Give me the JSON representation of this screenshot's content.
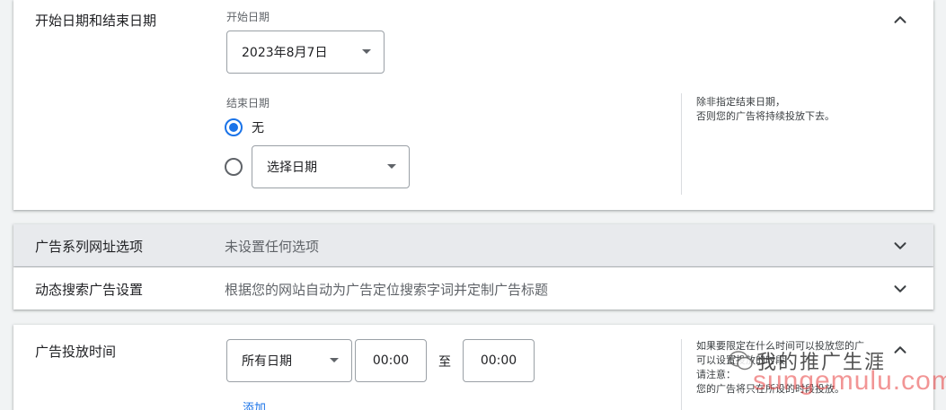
{
  "date_section": {
    "title": "开始日期和结束日期",
    "start_label": "开始日期",
    "start_value": "2023年8月7日",
    "end_label": "结束日期",
    "end_none": "无",
    "end_pick_placeholder": "选择日期",
    "help_line1": "除非指定结束日期，",
    "help_line2": "否则您的广告将持续投放下去。"
  },
  "url_section": {
    "title": "广告系列网址选项",
    "summary": "未设置任何选项"
  },
  "dsa_section": {
    "title": "动态搜索广告设置",
    "summary": "根据您的网站自动为广告定位搜索字词并定制广告标题"
  },
  "schedule_section": {
    "title": "广告投放时间",
    "day_select": "所有日期",
    "start_time": "00:00",
    "to": "至",
    "end_time": "00:00",
    "add_link": "添加",
    "help_line1": "如果要限定在什么时间可以投放您的广",
    "help_line2": "可以设置投放的时段",
    "help_line3": "请注意：",
    "help_line4": "您的广告将只在所设的时段投放。"
  },
  "watermark": {
    "cn": "我的推广生涯",
    "en": "sungemulu.com"
  },
  "colors": {
    "accent": "#1a73e8",
    "collapsed_header": "#e8eaed"
  }
}
